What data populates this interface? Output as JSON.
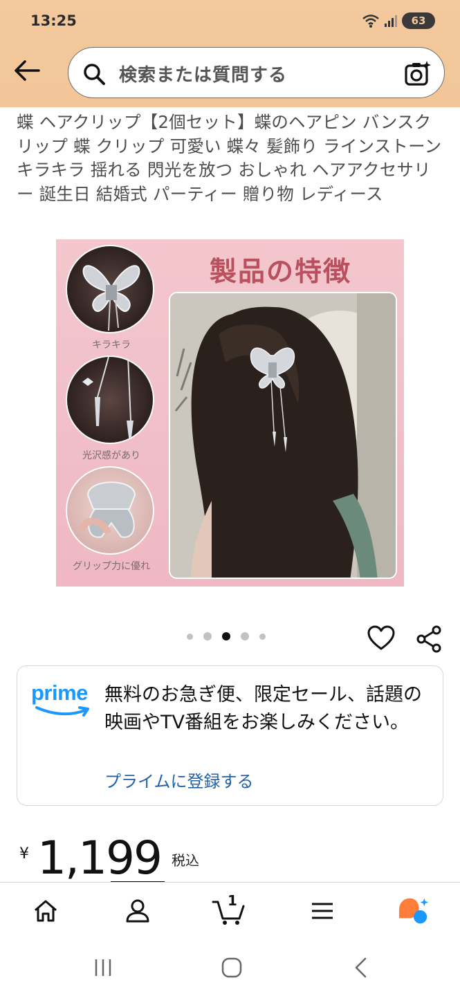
{
  "status": {
    "time": "13:25",
    "battery": "63"
  },
  "search": {
    "placeholder": "検索または質問する"
  },
  "product": {
    "title": "蝶 ヘアクリップ【2個セット】蝶のヘアピン バンスクリップ 蝶 クリップ 可愛い 蝶々 髪飾り ラインストーン キラキラ 揺れる 閃光を放つ おしゃれ ヘアアクセサリー 誕生日 結婚式 パーティー 贈り物 レディース",
    "image": {
      "heading": "製品の特徴",
      "captions": [
        "キラキラ",
        "光沢感があり",
        "グリップ力に優れ"
      ]
    },
    "carousel": {
      "count": 5,
      "active_index": 2
    }
  },
  "prime": {
    "logo": "prime",
    "text": "無料のお急ぎ便、限定セール、話題の映画やTV番組をお楽しみください。",
    "link": "プライムに登録する"
  },
  "price": {
    "currency": "¥",
    "amount": "1,199",
    "tax_label": "税込"
  },
  "bottom_nav": {
    "items": [
      "home-icon",
      "account-icon",
      "cart-icon",
      "menu-icon",
      "rufus-icon"
    ],
    "cart_count": "1"
  },
  "colors": {
    "header": "#f3c99d",
    "link": "#2161a8",
    "prime_blue": "#1a98ff",
    "rufus_orange": "#ff7d3a"
  }
}
